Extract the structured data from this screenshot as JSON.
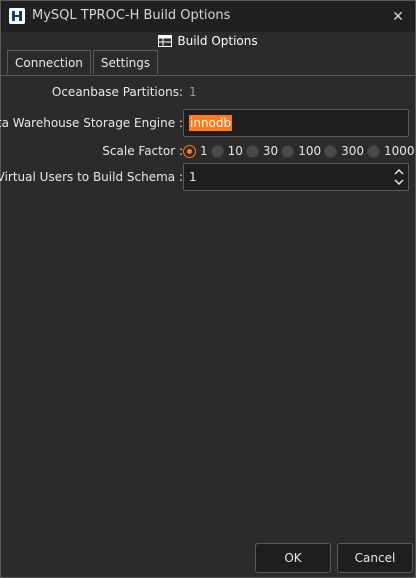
{
  "window": {
    "title": "MySQL TPROC-H Build Options",
    "close_glyph": "✕"
  },
  "header": {
    "icon": "table-icon",
    "title": "Build Options"
  },
  "tabs": [
    {
      "label": "Connection",
      "active": true
    },
    {
      "label": "Settings",
      "active": false
    }
  ],
  "form": {
    "partitions": {
      "label": "Oceanbase Partitions:",
      "value": "1"
    },
    "storage_engine": {
      "label": "Data Warehouse Storage Engine :",
      "value": "innodb"
    },
    "scale_factor": {
      "label": "Scale Factor :",
      "options": [
        "1",
        "10",
        "30",
        "100",
        "300",
        "1000"
      ],
      "selected": "1"
    },
    "virtual_users": {
      "label": "Virtual Users to Build Schema :",
      "value": "1"
    }
  },
  "buttons": {
    "ok": "OK",
    "cancel": "Cancel"
  },
  "colors": {
    "accent": "#ff7a1a",
    "background": "#2b2b2b",
    "titlebar": "#202020",
    "input_bg": "#1e1e1e"
  }
}
